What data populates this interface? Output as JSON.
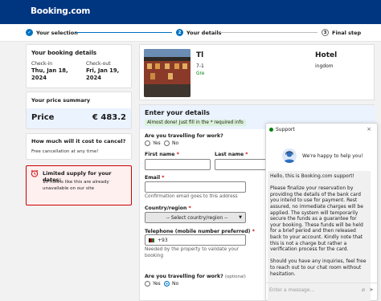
{
  "header": {
    "logo": "Booking.com"
  },
  "steps": [
    {
      "label": "Your selection",
      "state": "done"
    },
    {
      "number": "2",
      "label": "Your details",
      "state": "current"
    },
    {
      "number": "3",
      "label": "Final step",
      "state": "upcoming"
    }
  ],
  "booking_details": {
    "title": "Your booking details",
    "checkin_label": "Check-in",
    "checkin_date": "Thu, Jan 18,",
    "checkin_year": "2024",
    "checkout_label": "Check-out",
    "checkout_date": "Fri, Jan 19,",
    "checkout_year": "2024"
  },
  "price_summary": {
    "title": "Your price summary",
    "price_label": "Price",
    "price_value": "€ 483.2"
  },
  "cancel": {
    "title": "How much will it cost to cancel?",
    "text": "Free cancellation at any time!"
  },
  "alert": {
    "title": "Limited supply for your dates:",
    "text_line1": "10 hotels like this are already",
    "text_line2": "unavailable on our site"
  },
  "hotel": {
    "name_left": "Tl",
    "name_right": "Hotel",
    "addr_left": "7-1",
    "addr_right": "ingdom",
    "green_text": "Gre"
  },
  "form": {
    "title": "Enter your details",
    "badge": "Almost done! Just fill in the * required info",
    "travel_question": "Are you travelling for work?",
    "yes": "Yes",
    "no": "No",
    "first_name_label": "First name",
    "last_name_label": "Last name",
    "required_mark": "*",
    "email_label": "Email",
    "email_hint": "Confirmation email goes to this address",
    "country_label": "Country/region",
    "country_value": "-- Select country/region --",
    "phone_label": "Telephone (mobile number preferred)",
    "phone_prefix": "+93",
    "phone_hint_line1": "Needed by the property to validate your",
    "phone_hint_line2": "booking",
    "travel_question2": "Are you travelling for work?",
    "optional": "(optional)",
    "yes2": "Yes",
    "no2": "No"
  },
  "chat": {
    "title": "Support",
    "greeting": "We're happy to help you!",
    "message_p1": "Hello, this is Booking.com support!",
    "message_p2": "Please finalize your reservation by providing the details of the bank card you intend to use for payment. Rest assured, no immediate charges will be applied. The system will temporarily secure the funds as a guarantee for your booking. These funds will be held for a brief period and then released back to your account. Kindly note that this is not a charge but rather a verification process for the card.",
    "message_p3": "Should you have any inquiries, feel free to reach out to our chat room without hesitation.",
    "input_placeholder": "Enter a message...",
    "close": "×"
  },
  "colors": {
    "brand": "#003580",
    "accent": "#0071c2",
    "alert_red": "#cc0000",
    "success_green": "#008009"
  }
}
